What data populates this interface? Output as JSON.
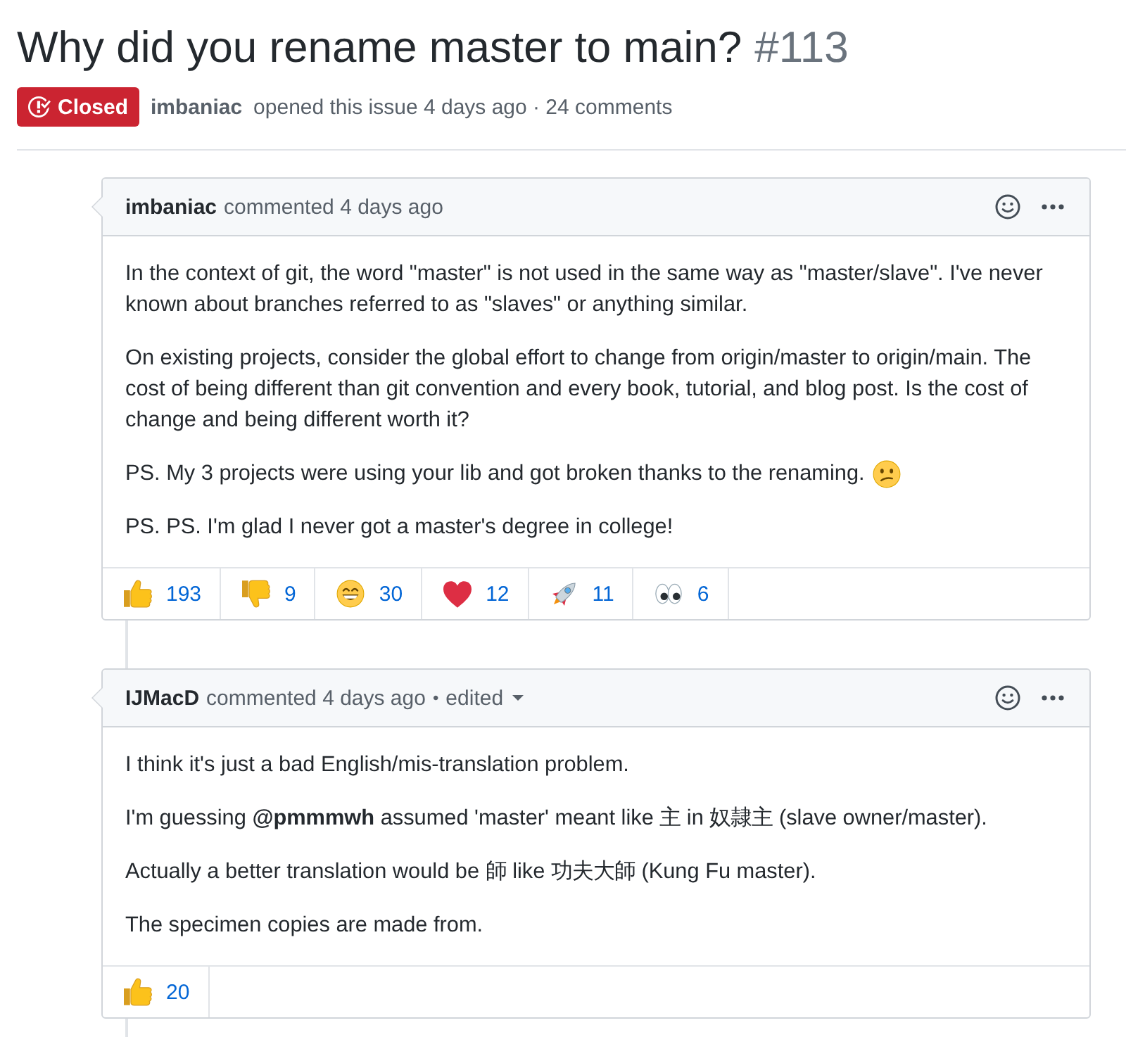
{
  "issue": {
    "title": "Why did you rename master to main?",
    "number": "#113",
    "state": {
      "kind": "closed",
      "label": "Closed"
    },
    "author": "imbaniac",
    "summary": "opened this issue 4 days ago · 24 comments"
  },
  "comments": [
    {
      "author": "imbaniac",
      "action": "commented 4 days ago",
      "paragraphs": [
        {
          "kind": "text",
          "text": "In the context of git, the word \"master\" is not used in the same way as \"master/slave\". I've never known about branches referred to as \"slaves\" or anything similar."
        },
        {
          "kind": "text",
          "text": "On existing projects, consider the global effort to change from origin/master to origin/main. The cost of being different than git convention and every book, tutorial, and blog post. Is the cost of change and being different worth it?"
        },
        {
          "kind": "emoji",
          "text": "PS. My 3 projects were using your lib and got broken thanks to the renaming."
        },
        {
          "kind": "text",
          "text": "PS. PS. I'm glad I never got a master's degree in college!"
        }
      ],
      "reactions": [
        {
          "kind": "thumbsup",
          "count": "193"
        },
        {
          "kind": "thumbsdown",
          "count": "9"
        },
        {
          "kind": "laugh",
          "count": "30"
        },
        {
          "kind": "heart",
          "count": "12"
        },
        {
          "kind": "rocket",
          "count": "11"
        },
        {
          "kind": "eyes",
          "count": "6"
        }
      ]
    },
    {
      "author": "IJMacD",
      "action": "commented 4 days ago",
      "edited": {
        "separator": "•",
        "label": "edited"
      },
      "paragraphs": [
        {
          "kind": "text",
          "text": "I think it's just a bad English/mis-translation problem."
        },
        {
          "kind": "text",
          "text": "I'm guessing **@pmmmwh** assumed 'master' meant like 主 in 奴隷主 (slave owner/master)."
        },
        {
          "kind": "text",
          "text": "Actually a better translation would be 師 like 功夫大師 (Kung Fu master)."
        },
        {
          "kind": "text",
          "text": "The specimen copies are made from."
        }
      ],
      "reactions": [
        {
          "kind": "thumbsup",
          "count": "20"
        }
      ]
    }
  ]
}
